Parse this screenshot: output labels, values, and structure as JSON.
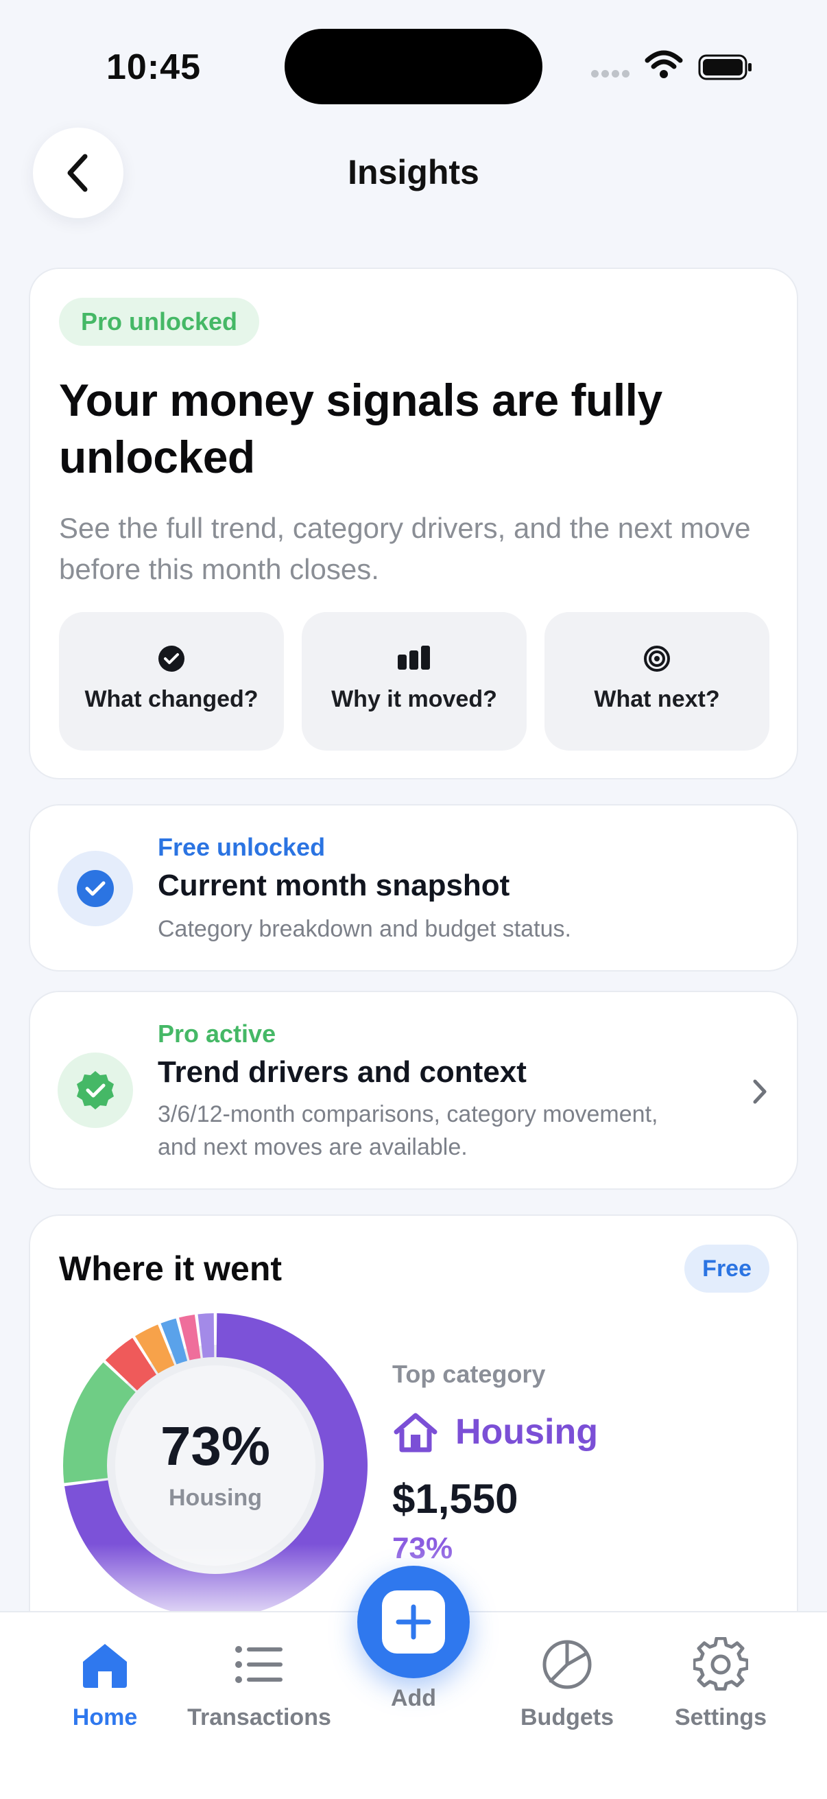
{
  "status_bar": {
    "time": "10:45"
  },
  "header": {
    "title": "Insights"
  },
  "hero": {
    "badge": "Pro unlocked",
    "title": "Your money signals are fully unlocked",
    "subtitle": "See the full trend, category drivers, and the next move before this month closes.",
    "questions": [
      {
        "label": "What changed?",
        "icon": "check-circle-icon"
      },
      {
        "label": "Why it moved?",
        "icon": "bar-chart-icon"
      },
      {
        "label": "What next?",
        "icon": "target-icon"
      }
    ]
  },
  "tiers": [
    {
      "kicker": "Free unlocked",
      "title": "Current month snapshot",
      "desc": "Category breakdown and budget status.",
      "icon": "check-badge-icon",
      "color": "#2b74e2"
    },
    {
      "kicker": "Pro active",
      "title": "Trend drivers and context",
      "desc": "3/6/12-month comparisons, category movement, and next moves are available.",
      "icon": "verified-badge-icon",
      "color": "#45b866"
    }
  ],
  "where": {
    "title": "Where it went",
    "badge": "Free",
    "center_pct": "73%",
    "center_label": "Housing",
    "top_label": "Top category",
    "top_name": "Housing",
    "top_amount": "$1,550",
    "top_pct": "73%"
  },
  "chart_data": {
    "type": "pie",
    "categories": [
      "Housing",
      "Green",
      "Red",
      "Orange",
      "Blue",
      "Pink",
      "Purple"
    ],
    "values": [
      73,
      14,
      4,
      3,
      2,
      2,
      2
    ],
    "colors": [
      "#7c52d8",
      "#6fcd85",
      "#ef5a5a",
      "#f7a24a",
      "#5aa2ea",
      "#ef6e9b",
      "#a38ae8"
    ]
  },
  "tabbar": {
    "tabs": [
      {
        "label": "Home",
        "icon": "home-icon",
        "active": true
      },
      {
        "label": "Transactions",
        "icon": "list-icon",
        "active": false
      },
      {
        "label": "Budgets",
        "icon": "pie-chart-icon",
        "active": false
      },
      {
        "label": "Settings",
        "icon": "gear-icon",
        "active": false
      }
    ],
    "add_label": "Add"
  },
  "colors": {
    "accent": "#2f78ee",
    "purple": "#7b4fd6",
    "green": "#45b866"
  }
}
